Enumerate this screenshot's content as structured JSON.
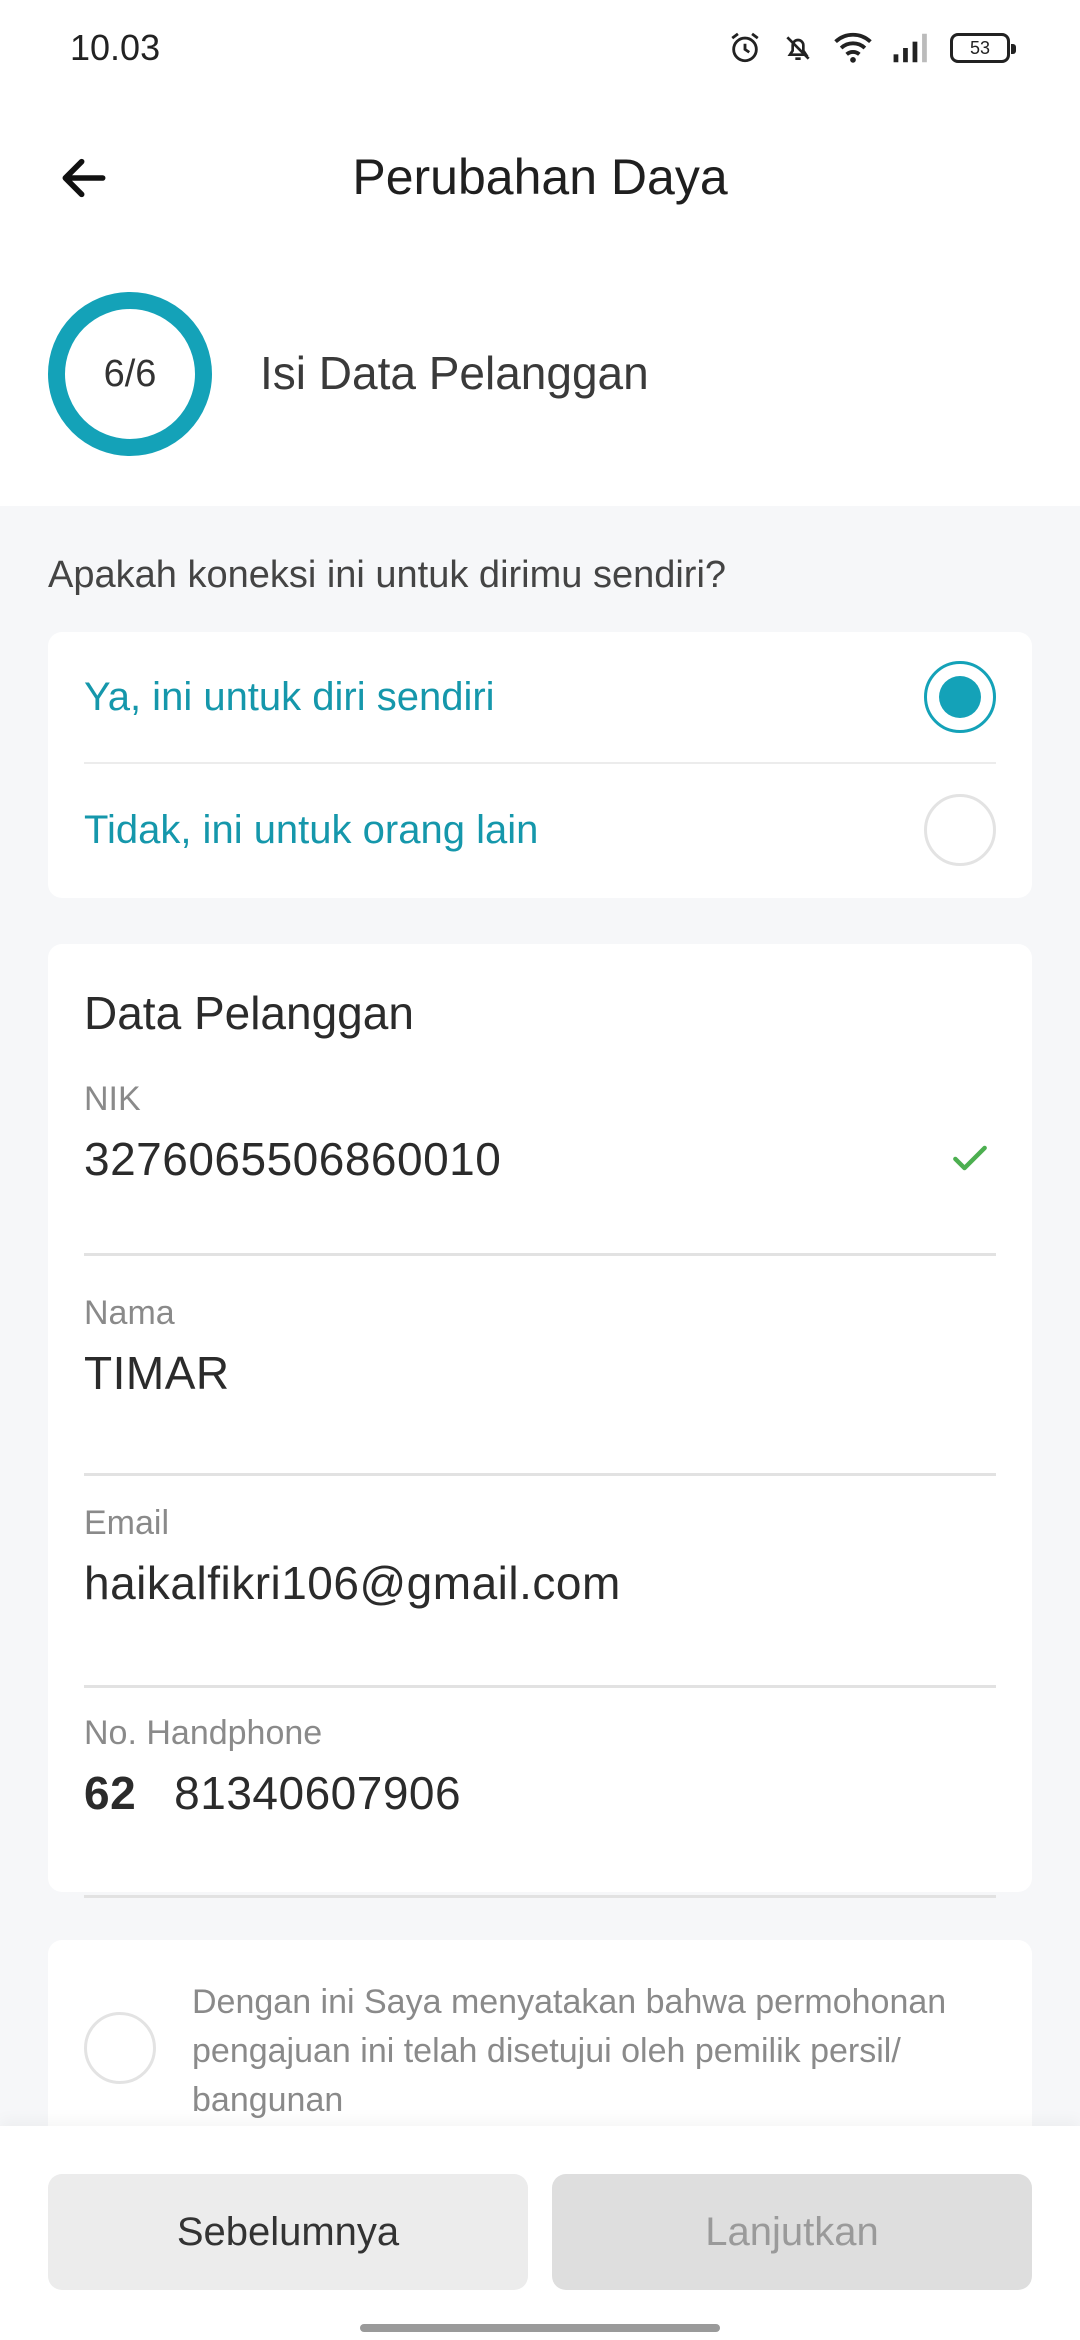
{
  "status_bar": {
    "time": "10.03",
    "battery": "53"
  },
  "header": {
    "title": "Perubahan Daya"
  },
  "step": {
    "progress": "6/6",
    "label": "Isi Data Pelanggan"
  },
  "connection_question": {
    "text": "Apakah koneksi ini untuk dirimu sendiri?",
    "options": [
      {
        "label": "Ya, ini untuk diri sendiri",
        "selected": true
      },
      {
        "label": "Tidak, ini untuk orang lain",
        "selected": false
      }
    ]
  },
  "customer_data": {
    "title": "Data Pelanggan",
    "nik": {
      "label": "NIK",
      "value": "3276065506860010"
    },
    "nama": {
      "label": "Nama",
      "value": "TIMAR"
    },
    "email": {
      "label": "Email",
      "value": "haikalfikri106@gmail.com"
    },
    "phone": {
      "label": "No. Handphone",
      "code": "62",
      "value": "81340607906"
    }
  },
  "agreement": {
    "text": "Dengan ini Saya menyatakan bahwa permohonan pengajuan ini telah disetujui oleh pemilik persil/ bangunan"
  },
  "buttons": {
    "previous": "Sebelumnya",
    "next": "Lanjutkan"
  },
  "colors": {
    "accent": "#14a2b8",
    "check": "#4caf50"
  }
}
